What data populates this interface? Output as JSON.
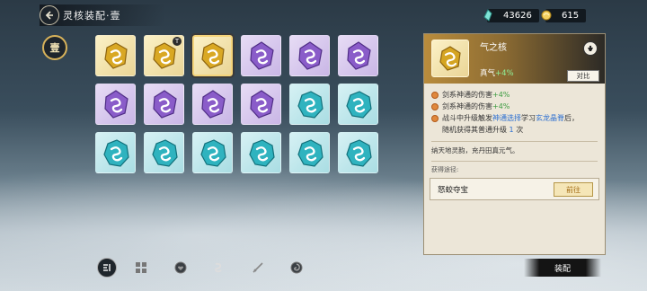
{
  "header": {
    "title": "灵核装配·壹"
  },
  "currency": {
    "jade": "43626",
    "gold": "615"
  },
  "tier": {
    "label": "壹"
  },
  "grid": {
    "rows": [
      [
        "gold",
        "gold",
        "gold",
        "purple",
        "purple",
        "purple"
      ],
      [
        "purple",
        "purple",
        "purple",
        "purple",
        "teal",
        "teal"
      ],
      [
        "teal",
        "teal",
        "teal",
        "teal",
        "teal",
        "teal"
      ]
    ],
    "selected": [
      0,
      2
    ],
    "equipped_tag": {
      "cell": [
        0,
        1
      ],
      "label": "T"
    }
  },
  "detail": {
    "name": "气之核",
    "stat_label": "真气",
    "stat_value": "+4%",
    "compare_label": "对比",
    "effects": [
      {
        "text": "剑系神通的伤害",
        "value": "+4%"
      },
      {
        "text": "剑系神通的伤害",
        "value": "+4%"
      }
    ],
    "effect3": {
      "p1": "战斗中升级触发",
      "h1": "神通选择",
      "p2": "学习",
      "h2": "玄龙晶脊",
      "p3": "后，",
      "line2a": "随机获得其普通升级",
      "line2num": "1",
      "line2b": "次"
    },
    "flavor": "纳天地灵韵，充丹田真元气。",
    "source_label": "获得途径:",
    "source_name": "怒蛟夺宝",
    "goto_label": "前往"
  },
  "equip_button": {
    "label": "装配"
  },
  "colors": {
    "gold_cell": "#ead596",
    "purple_cell": "#c9b6e6",
    "teal_cell": "#a9dde3",
    "green_value": "#3c9b41",
    "blue_highlight": "#2c6fd1"
  },
  "filters": [
    "sort-icon",
    "grid-filter-icon",
    "heart-filter-icon",
    "swirl-filter-icon",
    "sword-filter-icon",
    "vortex-filter-icon"
  ]
}
